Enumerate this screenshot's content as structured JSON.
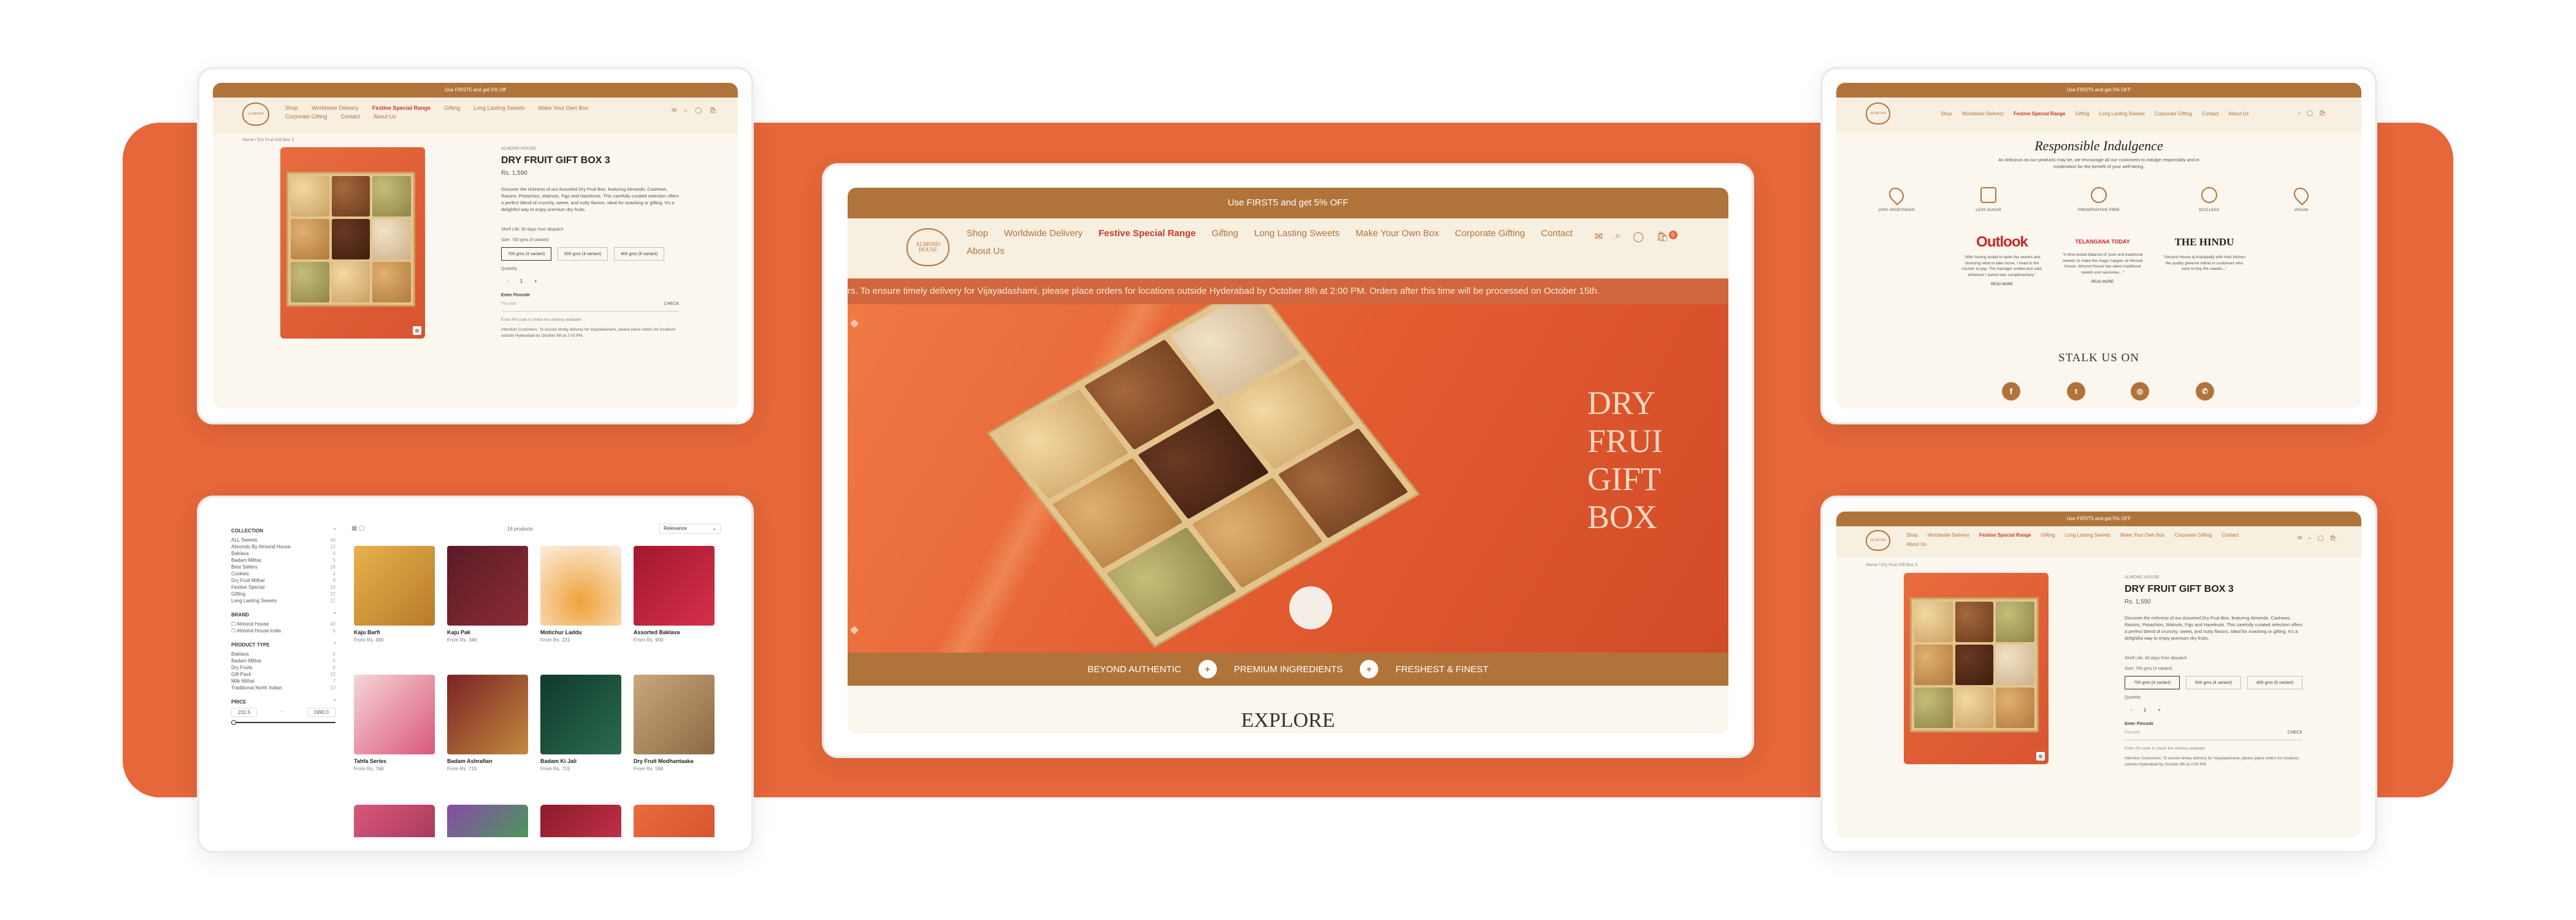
{
  "site": {
    "promo": "Use FIRST5 and get 5% Off",
    "promo_small": "Use FIRST5 and get 5% OFF",
    "logo_line1": "ALMOND",
    "logo_line2": "HOUSE",
    "nav": [
      "Shop",
      "Worldwide Delivery",
      "Festive Special Range",
      "Gifting",
      "Long Lasting Sweets",
      "Make Your Own Box",
      "Corporate Gifting",
      "Contact",
      "About Us"
    ]
  },
  "hero": {
    "promo": "Use FIRST5 and get 5% OFF",
    "ticker": "rs. To ensure timely delivery for Vijayadashami, please place orders for locations outside Hyderabad by October 8th at 2:00 PM. Orders after this time will be processed on October 15th.",
    "banner_line1": "DRY FRUI",
    "banner_line2": "GIFT BOX",
    "features": [
      "BEYOND AUTHENTIC",
      "PREMIUM INGREDIENTS",
      "FRESHEST & FINEST"
    ],
    "explore": "EXPLORE",
    "cart_count": "0"
  },
  "product": {
    "breadcrumb": "Home / Dry Fruit Gift Box 3",
    "vendor": "ALMOND HOUSE",
    "title": "DRY FRUIT GIFT BOX 3",
    "price": "Rs. 1,590",
    "description": "Discover the richness of our Assorted Dry Fruit Box, featuring Almonds, Cashews, Raisins, Pistachios, Walnuts, Figs and Hazelnuts. This carefully curated selection offers a perfect blend of crunchy, sweet, and nutty flavors. Ideal for snacking or gifting. It's a delightful way to enjoy premium dry fruits.",
    "shelf_life": "Shelf Life: 60 days from dispatch",
    "size_label": "Size: 700 gms (4 variant)",
    "sizes": [
      "700 gms (4 variant)",
      "500 gms (4 variant)",
      "400 gms (6 variant)"
    ],
    "quantity_label": "Quantity",
    "qty": "1",
    "minus": "-",
    "plus": "+",
    "pincode_label": "Enter Pincode",
    "pincode_placeholder": "Pincode",
    "check": "CHECK",
    "pincode_help": "Enter Pin code to check the delivery available",
    "attention": "Attention Customers: To ensure timely delivery for Vijayadashami, please place orders for locations outside Hyderabad by October 8th at 2:00 PM."
  },
  "listing": {
    "collection_label": "COLLECTION",
    "collections": [
      {
        "name": "ALL Sweets",
        "count": "46"
      },
      {
        "name": "Almonds By Almond House",
        "count": "12"
      },
      {
        "name": "Baklava",
        "count": "6"
      },
      {
        "name": "Badam Mithai",
        "count": "5"
      },
      {
        "name": "Best Sellers",
        "count": "18"
      },
      {
        "name": "Cookies",
        "count": "4"
      },
      {
        "name": "Dry Fruit Mithai",
        "count": "9"
      },
      {
        "name": "Festive Special",
        "count": "14"
      },
      {
        "name": "Gifting",
        "count": "22"
      },
      {
        "name": "Long Lasting Sweets",
        "count": "11"
      }
    ],
    "brand_label": "BRAND",
    "brands": [
      {
        "name": "Almond House",
        "count": "40"
      },
      {
        "name": "Almond House India",
        "count": "6"
      }
    ],
    "ptype_label": "PRODUCT TYPE",
    "ptypes": [
      {
        "name": "Baklava",
        "count": "6"
      },
      {
        "name": "Badam Mithai",
        "count": "5"
      },
      {
        "name": "Dry Fruits",
        "count": "8"
      },
      {
        "name": "Gift Pack",
        "count": "10"
      },
      {
        "name": "Milk Mithai",
        "count": "7"
      },
      {
        "name": "Traditional North Indian",
        "count": "10"
      }
    ],
    "price_label": "PRICE",
    "price_from": "231.5",
    "price_to": "1990.0",
    "price_dash": "-",
    "results": "16 products",
    "sort": "Relevance",
    "products": [
      {
        "name": "Kaju Barfi",
        "price": "From Rs. 490"
      },
      {
        "name": "Kaju Pak",
        "price": "From Rs. 346"
      },
      {
        "name": "Motichur Laddu",
        "price": "From Rs. 231"
      },
      {
        "name": "Assorted Baklava",
        "price": "From Rs. 900"
      },
      {
        "name": "Tahfa Series",
        "price": "From Rs. 768"
      },
      {
        "name": "Badam Ashrafian",
        "price": "From Rs. 715"
      },
      {
        "name": "Badam Ki Jali",
        "price": "From Rs. 715"
      },
      {
        "name": "Dry Fruit Modhantaaka",
        "price": "From Rs. 566"
      }
    ]
  },
  "about": {
    "title": "Responsible Indulgence",
    "subtitle": "As delicious as our products may be, we encourage all our customers to indulge responsibly and in moderation for the benefit of your well-being.",
    "badges": [
      "100% VEGETARIAN",
      "LESS SUGAR",
      "PRESERVATIVE FREE",
      "ECO-LESS",
      "VEGAN"
    ],
    "press": [
      {
        "name": "Outlook",
        "quote": "\"After having tasted to taste the sweets and choosing what to take home, I head to the counter to pay. The manager smiled and said, whatever I tasted was complimentary.\""
      },
      {
        "name": "TELANGANA TODAY",
        "quote": "\"A time-tested balance of 'pure and traditional sweets' to make the magic happen at Almond House. Almond House has taken traditional sweets and savouries...\""
      },
      {
        "name": "THE HINDU",
        "quote": "\"Almond House at Kukatpally with their kitchen the quality ghee/ve mithai to customers who want to buy the sweets...\""
      }
    ],
    "read_more": "READ MORE",
    "stalk": "STALK US ON",
    "social_icons": [
      "facebook-icon",
      "twitter-icon",
      "instagram-icon",
      "whatsapp-icon"
    ]
  }
}
